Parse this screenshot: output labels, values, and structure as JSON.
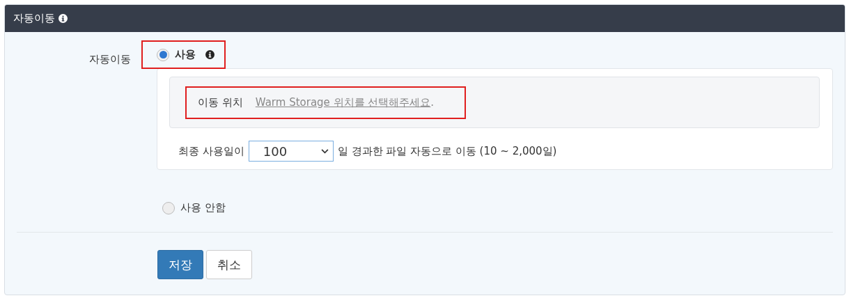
{
  "header": {
    "title": "자동이동"
  },
  "field": {
    "label": "자동이동",
    "options": [
      {
        "label": "사용",
        "selected": true,
        "highlighted": true
      },
      {
        "label": "사용 안함",
        "selected": false,
        "highlighted": false
      }
    ]
  },
  "destination": {
    "label": "이동 위치",
    "link": "Warm Storage 위치를 선택해주세요",
    "suffix": ".",
    "highlighted": true
  },
  "rule": {
    "prefix": "최종 사용일이",
    "value": "100",
    "suffix": "일 경과한 파일 자동으로 이동 (10 ~ 2,000일)"
  },
  "buttons": [
    {
      "label": "저장",
      "kind": "primary"
    },
    {
      "label": "취소",
      "kind": "default"
    }
  ]
}
